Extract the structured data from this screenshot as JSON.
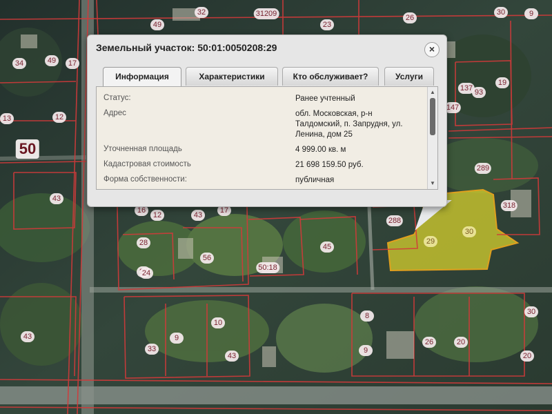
{
  "popup": {
    "title": "Земельный участок: 50:01:0050208:29",
    "close_label": "×",
    "tabs": [
      {
        "label": "Информация",
        "active": true
      },
      {
        "label": "Характеристики",
        "active": false
      },
      {
        "label": "Кто обслуживает?",
        "active": false
      },
      {
        "label": "Услуги",
        "active": false
      }
    ],
    "rows": [
      {
        "label": "Статус:",
        "value": "Ранее учтенный"
      },
      {
        "label": "Адрес",
        "value": "обл. Московская, р-н Талдомский, п. Запрудня, ул. Ленина, дом 25"
      },
      {
        "label": "Уточненная площадь",
        "value": "4 999.00 кв. м"
      },
      {
        "label": "Кадастровая стоимость",
        "value": "21 698 159.50 руб."
      },
      {
        "label": "Форма собственности:",
        "value": "публичная"
      }
    ]
  },
  "map": {
    "parcel_labels": [
      "30",
      "9",
      "26",
      "23",
      "31209",
      "49",
      "17",
      "34",
      "49",
      "12",
      "13",
      "50",
      "43",
      "24",
      "16",
      "17",
      "43",
      "12",
      "28",
      "56",
      "45",
      "43",
      "24",
      "50:18",
      "137",
      "93",
      "19",
      "147",
      "289",
      "288",
      "29",
      "30",
      "318",
      "10",
      "9",
      "8",
      "26",
      "20",
      "33",
      "43",
      "9",
      "30",
      "20",
      "32"
    ],
    "highlight_color": "#d6d02e",
    "boundary_color": "#d23a3a"
  }
}
